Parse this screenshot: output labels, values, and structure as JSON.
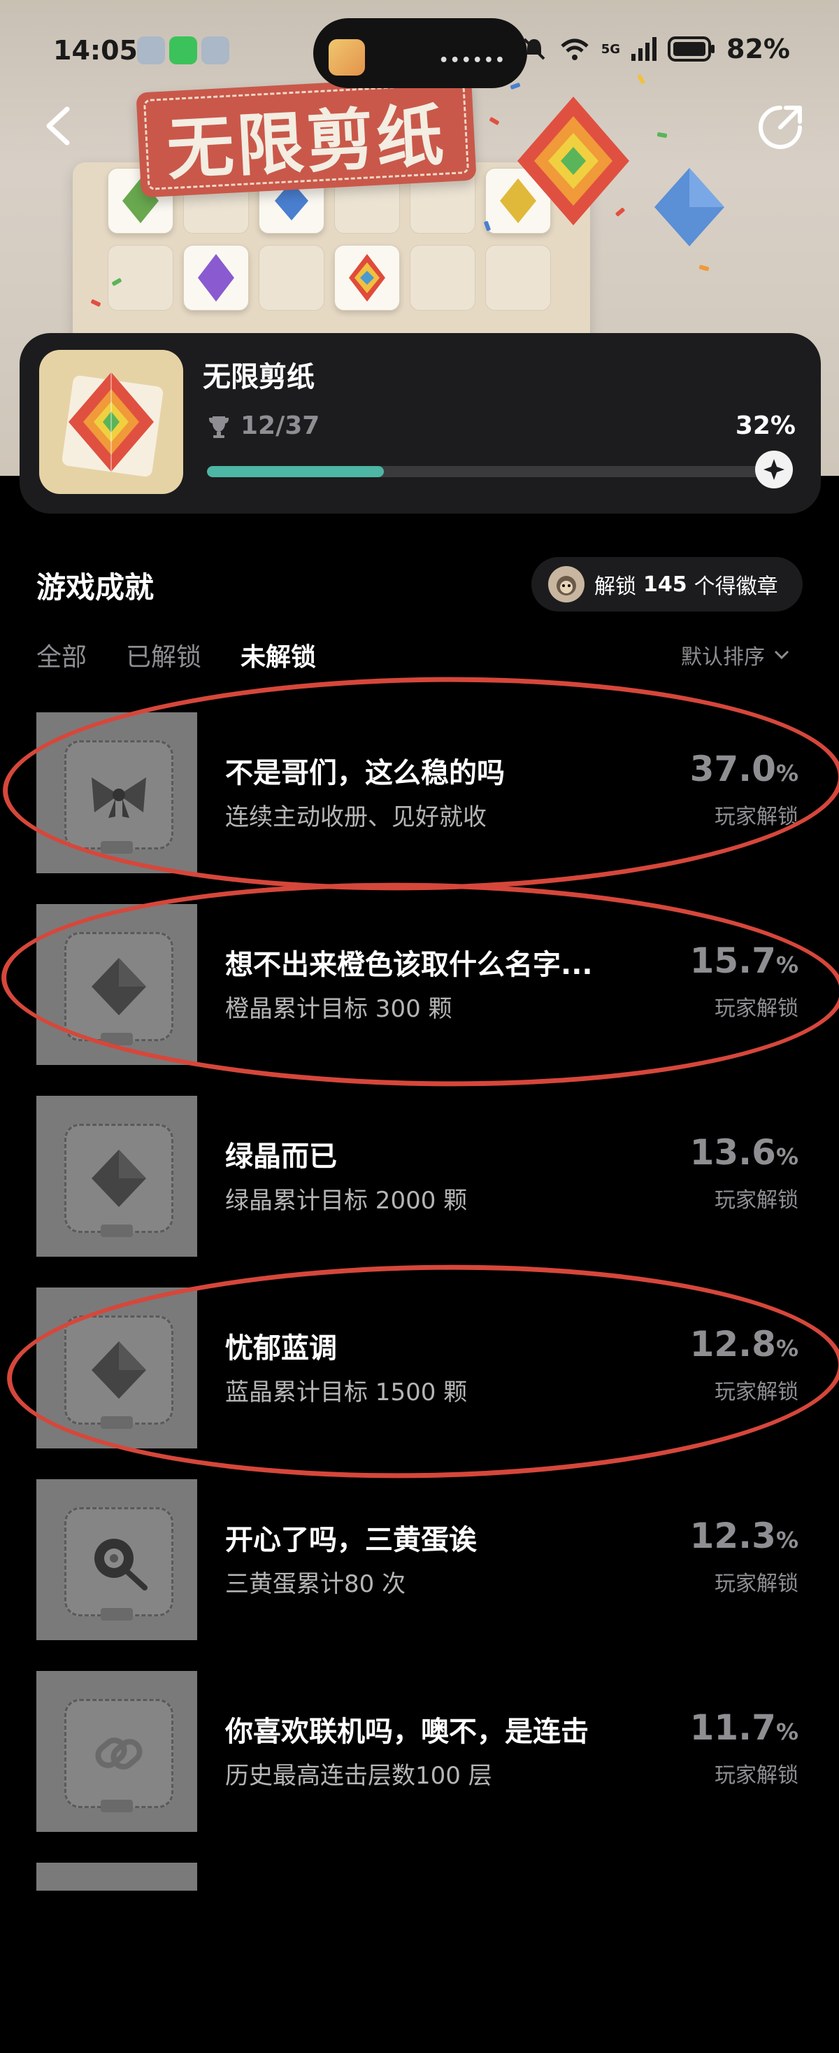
{
  "status_bar": {
    "time": "14:05",
    "battery": "82%",
    "network": "5G"
  },
  "hero": {
    "banner_title": "无限剪纸"
  },
  "game": {
    "name": "无限剪纸",
    "achievements_count": "12/37",
    "progress_percent": "32%",
    "progress_value": 0.32
  },
  "section": {
    "title": "游戏成就",
    "badge_text_prefix": "解锁",
    "badge_count": "145",
    "badge_text_suffix": "个得徽章"
  },
  "tabs": [
    {
      "label": "全部",
      "active": false
    },
    {
      "label": "已解锁",
      "active": false
    },
    {
      "label": "未解锁",
      "active": true
    }
  ],
  "sort_label": "默认排序",
  "achievements": [
    {
      "title": "不是哥们，这么稳的吗",
      "desc": "连续主动收册、见好就收",
      "pct": "37.0",
      "sub": "玩家解锁",
      "icon": "bow-icon"
    },
    {
      "title": "想不出来橙色该取什么名字...",
      "desc": "橙晶累计目标 300 颗",
      "pct": "15.7",
      "sub": "玩家解锁",
      "icon": "diamond-icon"
    },
    {
      "title": "绿晶而已",
      "desc": "绿晶累计目标 2000 颗",
      "pct": "13.6",
      "sub": "玩家解锁",
      "icon": "diamond-icon"
    },
    {
      "title": "忧郁蓝调",
      "desc": "蓝晶累计目标 1500 颗",
      "pct": "12.8",
      "sub": "玩家解锁",
      "icon": "diamond-icon"
    },
    {
      "title": "开心了吗，三黄蛋诶",
      "desc": "三黄蛋累计80 次",
      "pct": "12.3",
      "sub": "玩家解锁",
      "icon": "pan-icon"
    },
    {
      "title": "你喜欢联机吗，噢不，是连击",
      "desc": "历史最高连击层数100 层",
      "pct": "11.7",
      "sub": "玩家解锁",
      "icon": "chain-icon"
    }
  ],
  "pct_unit": "%",
  "colors": {
    "accent": "#4db6a4",
    "annotation_ring": "#d6473b",
    "card": "#1c1c1e"
  }
}
